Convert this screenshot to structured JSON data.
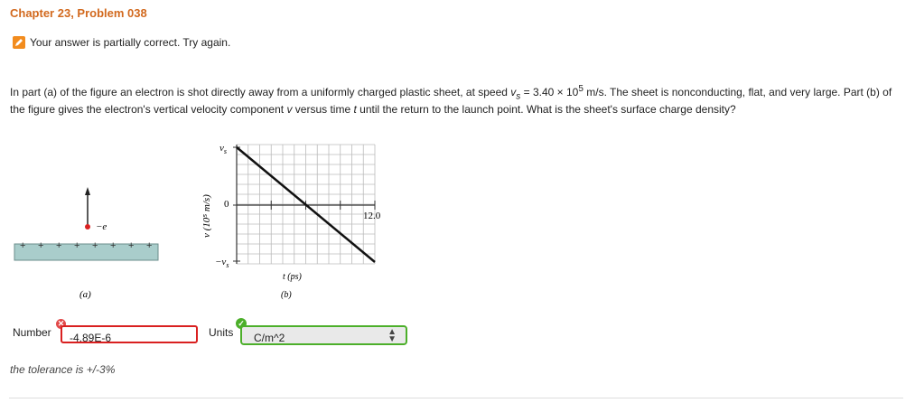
{
  "header": {
    "title": "Chapter 23, Problem 038"
  },
  "feedback": {
    "message": "Your answer is partially correct.  Try again."
  },
  "problem": {
    "text_part1": "In part (a) of the figure an electron is shot directly away from a uniformly charged plastic sheet, at speed ",
    "vs_symbol": "v",
    "vs_sub": "s",
    "text_part2": " = 3.40 × 10",
    "exp": "5",
    "text_part3": " m/s. The sheet is nonconducting, flat, and very large. Part (b) of the figure gives the electron's vertical velocity component ",
    "v_symbol": "v",
    "text_part4": " versus time ",
    "t_symbol": "t",
    "text_part5": " until the return to the launch point. What is the sheet's surface charge density?"
  },
  "figure": {
    "a": {
      "electron_label": "−e",
      "plus_signs": [
        "+",
        "+",
        "+",
        "+",
        "+",
        "+",
        "+",
        "+"
      ],
      "caption": "(a)"
    },
    "b": {
      "y_axis_label": "v (10⁵ m/s)",
      "y_top": "v",
      "y_top_sub": "s",
      "y_zero": "0",
      "y_bottom": "−v",
      "y_bottom_sub": "s",
      "x_end_label": "12.0",
      "x_axis_label": "t (ps)",
      "caption": "(b)"
    }
  },
  "answer": {
    "number_label": "Number",
    "number_value": "-4.89E-6",
    "units_label": "Units",
    "units_value": "C/m^2",
    "tolerance": "the tolerance is +/-3%"
  },
  "colors": {
    "title": "#d2691e",
    "error": "#d92020",
    "correct": "#4caf2a",
    "sheet": "#a9cdcb"
  }
}
